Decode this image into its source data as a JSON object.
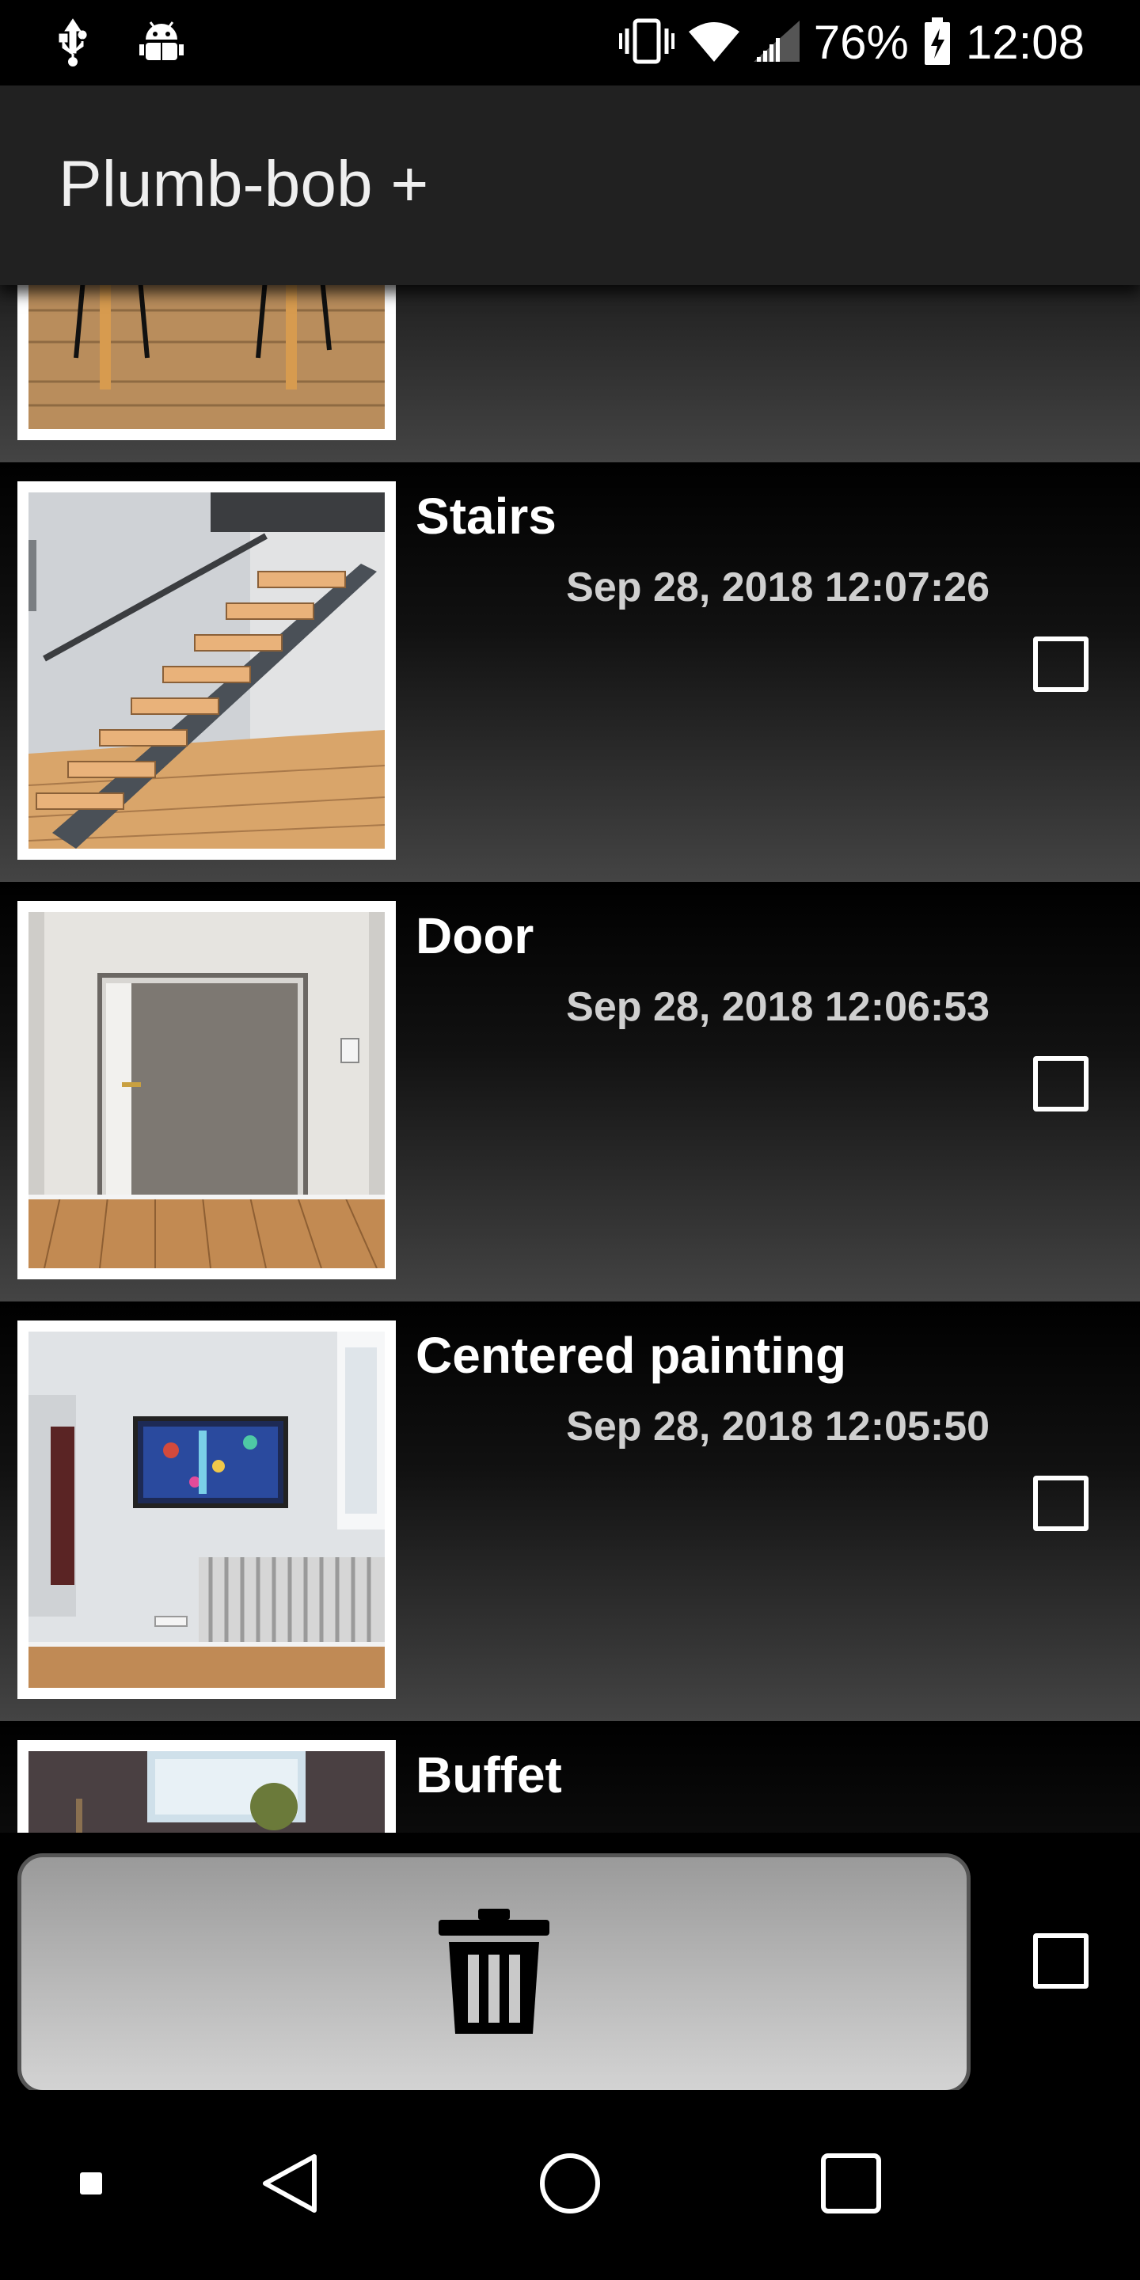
{
  "status_bar": {
    "icons": [
      "usb-icon",
      "android-debug-icon",
      "vibrate-icon",
      "wifi-icon",
      "signal-icon",
      "battery-charging-icon"
    ],
    "battery": "76%",
    "time": "12:08"
  },
  "app_bar": {
    "title": "Plumb-bob +"
  },
  "photos": [
    {
      "title": "",
      "date": "",
      "checked": false
    },
    {
      "title": "Stairs",
      "date": "Sep 28, 2018 12:07:26",
      "checked": false
    },
    {
      "title": "Door",
      "date": "Sep 28, 2018 12:06:53",
      "checked": false
    },
    {
      "title": "Centered painting",
      "date": "Sep 28, 2018 12:05:50",
      "checked": false
    },
    {
      "title": "Buffet",
      "date": "",
      "checked": false
    }
  ],
  "bottom_bar": {
    "delete_icon": "trash-icon",
    "select_all_checked": false
  },
  "nav_bar": {
    "icons": [
      "recent-dot-icon",
      "back-icon",
      "home-icon",
      "overview-icon"
    ]
  },
  "colors": {
    "app_bar": "#212121",
    "background": "#000000",
    "divider": "#bdbdbd",
    "button": "#bdbdbd"
  }
}
